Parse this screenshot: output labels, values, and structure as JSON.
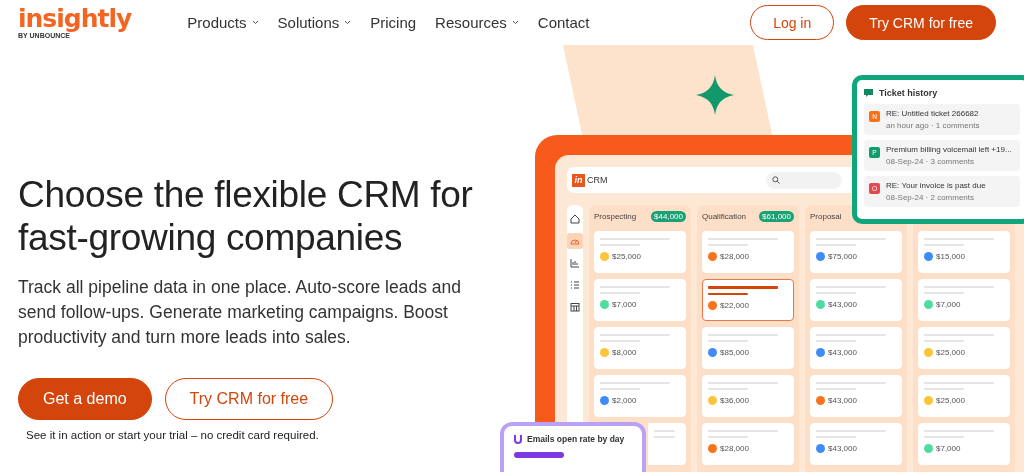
{
  "header": {
    "logo": "insightly",
    "logo_sub": "BY UNBOUNCE",
    "nav": [
      {
        "label": "Products",
        "has_menu": true
      },
      {
        "label": "Solutions",
        "has_menu": true
      },
      {
        "label": "Pricing",
        "has_menu": false
      },
      {
        "label": "Resources",
        "has_menu": true
      },
      {
        "label": "Contact",
        "has_menu": false
      }
    ],
    "buttons": [
      {
        "label": "Log in",
        "kind": "outline"
      },
      {
        "label": "Try CRM for free",
        "kind": "filled"
      }
    ]
  },
  "hero": {
    "headline": "Choose the flexible CRM for fast-growing companies",
    "body": "Track all pipeline data in one place. Auto-score leads and send follow-ups. Generate marketing campaigns. Boost productivity and turn more leads into sales.",
    "buttons": [
      {
        "label": "Get a demo",
        "kind": "filled"
      },
      {
        "label": "Try CRM for free",
        "kind": "outline"
      }
    ],
    "note": "See it in action or start your trial – no credit card required."
  },
  "crm": {
    "app_name": "CRM",
    "logo_mark": "in",
    "sidebar": [
      {
        "kind": "home",
        "selected": false
      },
      {
        "kind": "gauge",
        "selected": true
      },
      {
        "kind": "chart",
        "selected": false
      },
      {
        "kind": "list",
        "selected": false
      },
      {
        "kind": "calendar",
        "selected": false
      }
    ],
    "columns": [
      {
        "name": "Prospecting",
        "total": "$44,000",
        "cards": [
          {
            "amount": "$25,000",
            "color": "#fcc53a",
            "highlighted": false
          },
          {
            "amount": "$7,000",
            "color": "#4fdca0",
            "highlighted": false
          },
          {
            "amount": "$8,000",
            "color": "#fcc53a",
            "highlighted": false
          },
          {
            "amount": "$2,000",
            "color": "#3f8cf6",
            "highlighted": false
          },
          {
            "highlighted": false
          }
        ]
      },
      {
        "name": "Qualification",
        "total": "$61,000",
        "cards": [
          {
            "amount": "$28,000",
            "color": "#f9731c",
            "highlighted": false
          },
          {
            "amount": "$22,000",
            "color": "#f9731c",
            "highlighted": true
          },
          {
            "amount": "$85,000",
            "color": "#3f8cf6",
            "highlighted": false
          },
          {
            "amount": "$36,000",
            "color": "#fcc53a",
            "highlighted": false
          },
          {
            "amount": "$28,000",
            "color": "#f9731c",
            "highlighted": false
          }
        ]
      },
      {
        "name": "Proposal",
        "cards": [
          {
            "amount": "$75,000",
            "color": "#3f8cf6",
            "highlighted": false
          },
          {
            "amount": "$43,000",
            "color": "#4fdca0",
            "highlighted": false
          },
          {
            "amount": "$43,000",
            "color": "#3f8cf6",
            "highlighted": false
          },
          {
            "amount": "$43,000",
            "color": "#f9731c",
            "highlighted": false
          },
          {
            "amount": "$43,000",
            "color": "#3f8cf6",
            "highlighted": false
          }
        ]
      },
      {
        "cards": [
          {
            "amount": "$15,000",
            "color": "#3f8cf6",
            "highlighted": false
          },
          {
            "amount": "$7,000",
            "color": "#4fdca0",
            "highlighted": false
          },
          {
            "amount": "$25,000",
            "color": "#fcc53a",
            "highlighted": false
          },
          {
            "amount": "$25,000",
            "color": "#fcc53a",
            "highlighted": false
          },
          {
            "amount": "$7,000",
            "color": "#4fdca0",
            "highlighted": false
          }
        ]
      }
    ]
  },
  "ticket_history": {
    "title": "Ticket history",
    "tickets": [
      {
        "letter": "N",
        "color": "#f97316",
        "title": "RE: Untitled ticket 266682",
        "meta": "an hour ago · 1 comments"
      },
      {
        "letter": "P",
        "color": "#0f9d6e",
        "title": "Premium billing voicemail left +19...",
        "meta": "08-Sep-24 · 3 comments"
      },
      {
        "letter": "O",
        "color": "#e5484d",
        "title": "RE: Your invoice is past due",
        "meta": "08-Sep-24 · 2 comments"
      }
    ]
  },
  "email_card": {
    "title": "Emails open rate by day"
  }
}
